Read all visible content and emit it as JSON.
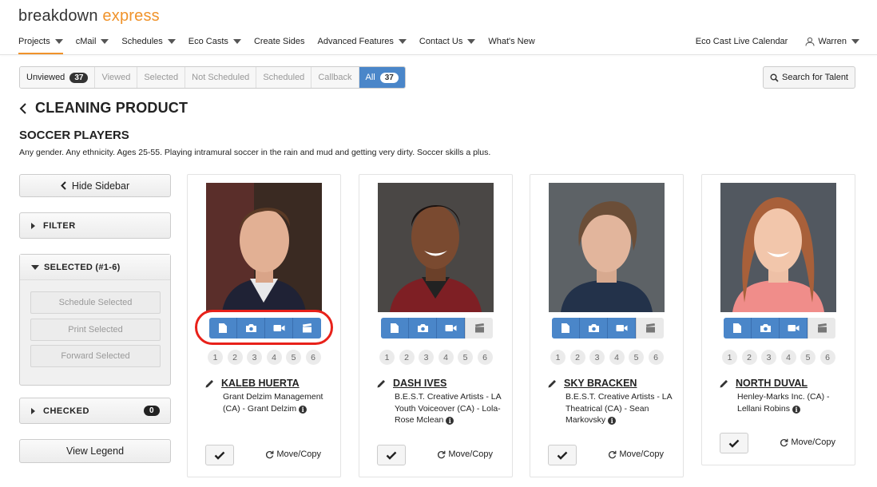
{
  "brand": {
    "part1": "breakdown",
    "part2": "express"
  },
  "nav": {
    "items": [
      {
        "label": "Projects",
        "caret": true
      },
      {
        "label": "cMail",
        "caret": true
      },
      {
        "label": "Schedules",
        "caret": true
      },
      {
        "label": "Eco Casts",
        "caret": true
      },
      {
        "label": "Create Sides",
        "caret": false
      },
      {
        "label": "Advanced Features",
        "caret": true
      },
      {
        "label": "Contact Us",
        "caret": true
      },
      {
        "label": "What's New",
        "caret": false
      }
    ],
    "calendar": "Eco Cast Live Calendar",
    "user": "Warren"
  },
  "tabs": {
    "unviewed": "Unviewed",
    "unviewed_count": "37",
    "viewed": "Viewed",
    "selected": "Selected",
    "not_scheduled": "Not Scheduled",
    "scheduled": "Scheduled",
    "callback": "Callback",
    "all": "All",
    "all_count": "37"
  },
  "search_talent": "Search for Talent",
  "project_title": "CLEANING PRODUCT",
  "role": {
    "title": "SOCCER PLAYERS",
    "description": "Any gender. Any ethnicity. Ages 25-55. Playing intramural soccer in the rain and mud and getting very dirty. Soccer skills a plus."
  },
  "sidebar": {
    "hide": "Hide Sidebar",
    "filter": "FILTER",
    "selected_header": "SELECTED (#1-6)",
    "schedule_selected": "Schedule Selected",
    "print_selected": "Print Selected",
    "forward_selected": "Forward Selected",
    "checked": "CHECKED",
    "checked_count": "0",
    "view_legend": "View Legend"
  },
  "slot_numbers": [
    "1",
    "2",
    "3",
    "4",
    "5",
    "6"
  ],
  "move_copy": "Move/Copy",
  "talents": [
    {
      "name": "KALEB HUERTA",
      "agency": "Grant Delzim Management (CA) - Grant Delzim"
    },
    {
      "name": "DASH IVES",
      "agency": "B.E.S.T. Creative Artists - LA Youth Voiceover (CA) - Lola-Rose Mclean"
    },
    {
      "name": "SKY BRACKEN",
      "agency": "B.E.S.T. Creative Artists - LA Theatrical (CA) - Sean Markovsky"
    },
    {
      "name": "NORTH DUVAL",
      "agency": "Henley-Marks Inc. (CA) - Lellani Robins"
    }
  ],
  "colors": {
    "accent": "#f0932b",
    "primary": "#4a86c9",
    "highlight": "#e8211a"
  }
}
